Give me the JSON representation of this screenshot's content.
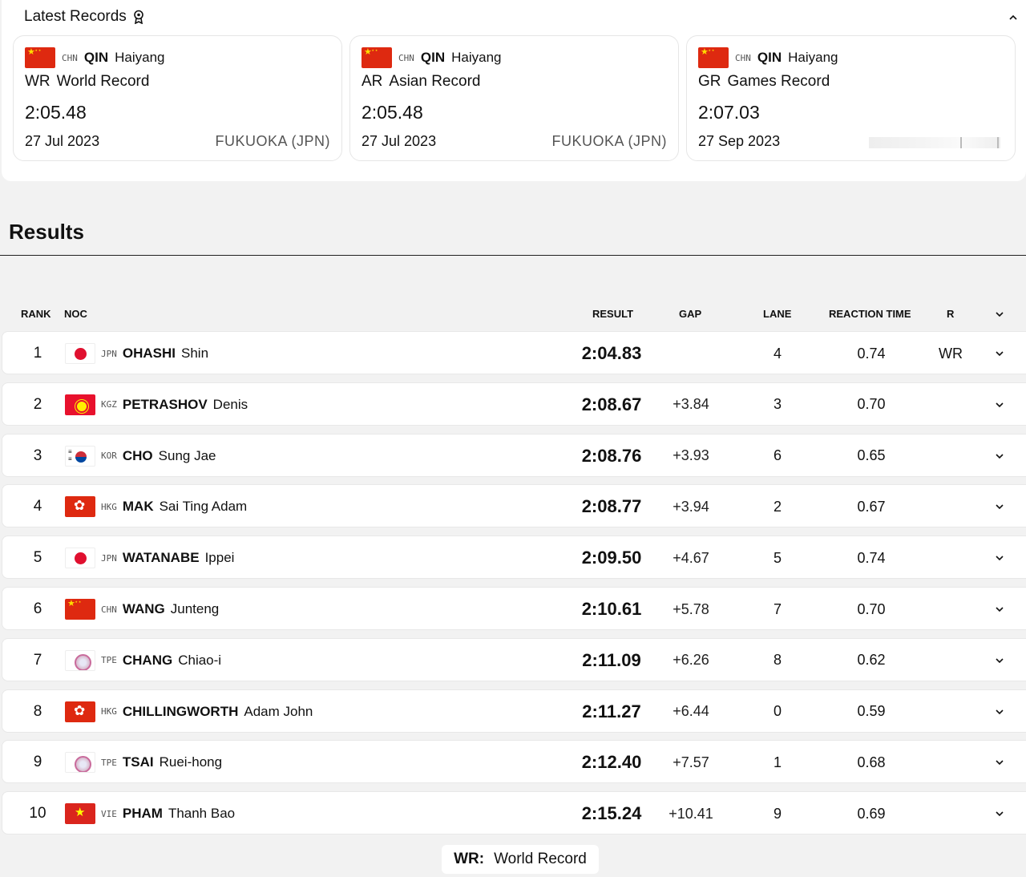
{
  "records": {
    "title": "Latest Records",
    "collapse_icon": "chevron-up-icon",
    "cards": [
      {
        "noc": "CHN",
        "flag": "chn",
        "last": "QIN",
        "first": "Haiyang",
        "code": "WR",
        "label": "World Record",
        "time": "2:05.48",
        "date": "27 Jul 2023",
        "venue": "FUKUOKA (JPN)"
      },
      {
        "noc": "CHN",
        "flag": "chn",
        "last": "QIN",
        "first": "Haiyang",
        "code": "AR",
        "label": "Asian Record",
        "time": "2:05.48",
        "date": "27 Jul 2023",
        "venue": "FUKUOKA (JPN)"
      },
      {
        "noc": "CHN",
        "flag": "chn",
        "last": "QIN",
        "first": "Haiyang",
        "code": "GR",
        "label": "Games Record",
        "time": "2:07.03",
        "date": "27 Sep 2023",
        "venue": ""
      }
    ]
  },
  "results": {
    "title": "Results",
    "columns": {
      "rank": "RANK",
      "noc": "NOC",
      "result": "RESULT",
      "gap": "GAP",
      "lane": "LANE",
      "reaction": "REACTION TIME",
      "r": "R"
    },
    "rows": [
      {
        "rank": "1",
        "noc": "JPN",
        "flag": "jpn",
        "last": "OHASHI",
        "first": "Shin",
        "result": "2:04.83",
        "gap": "",
        "lane": "4",
        "rt": "0.74",
        "rec": "WR"
      },
      {
        "rank": "2",
        "noc": "KGZ",
        "flag": "kgz",
        "last": "PETRASHOV",
        "first": "Denis",
        "result": "2:08.67",
        "gap": "+3.84",
        "lane": "3",
        "rt": "0.70",
        "rec": ""
      },
      {
        "rank": "3",
        "noc": "KOR",
        "flag": "kor",
        "last": "CHO",
        "first": "Sung Jae",
        "result": "2:08.76",
        "gap": "+3.93",
        "lane": "6",
        "rt": "0.65",
        "rec": ""
      },
      {
        "rank": "4",
        "noc": "HKG",
        "flag": "hkg",
        "last": "MAK",
        "first": "Sai Ting Adam",
        "result": "2:08.77",
        "gap": "+3.94",
        "lane": "2",
        "rt": "0.67",
        "rec": ""
      },
      {
        "rank": "5",
        "noc": "JPN",
        "flag": "jpn",
        "last": "WATANABE",
        "first": "Ippei",
        "result": "2:09.50",
        "gap": "+4.67",
        "lane": "5",
        "rt": "0.74",
        "rec": ""
      },
      {
        "rank": "6",
        "noc": "CHN",
        "flag": "chn",
        "last": "WANG",
        "first": "Junteng",
        "result": "2:10.61",
        "gap": "+5.78",
        "lane": "7",
        "rt": "0.70",
        "rec": ""
      },
      {
        "rank": "7",
        "noc": "TPE",
        "flag": "tpe",
        "last": "CHANG",
        "first": "Chiao-i",
        "result": "2:11.09",
        "gap": "+6.26",
        "lane": "8",
        "rt": "0.62",
        "rec": ""
      },
      {
        "rank": "8",
        "noc": "HKG",
        "flag": "hkg",
        "last": "CHILLINGWORTH",
        "first": "Adam John",
        "result": "2:11.27",
        "gap": "+6.44",
        "lane": "0",
        "rt": "0.59",
        "rec": ""
      },
      {
        "rank": "9",
        "noc": "TPE",
        "flag": "tpe",
        "last": "TSAI",
        "first": "Ruei-hong",
        "result": "2:12.40",
        "gap": "+7.57",
        "lane": "1",
        "rt": "0.68",
        "rec": ""
      },
      {
        "rank": "10",
        "noc": "VIE",
        "flag": "vie",
        "last": "PHAM",
        "first": "Thanh Bao",
        "result": "2:15.24",
        "gap": "+10.41",
        "lane": "9",
        "rt": "0.69",
        "rec": ""
      }
    ],
    "toggle_icon": "chevron-down-icon"
  },
  "legend": {
    "code": "WR:",
    "label": "World Record"
  }
}
